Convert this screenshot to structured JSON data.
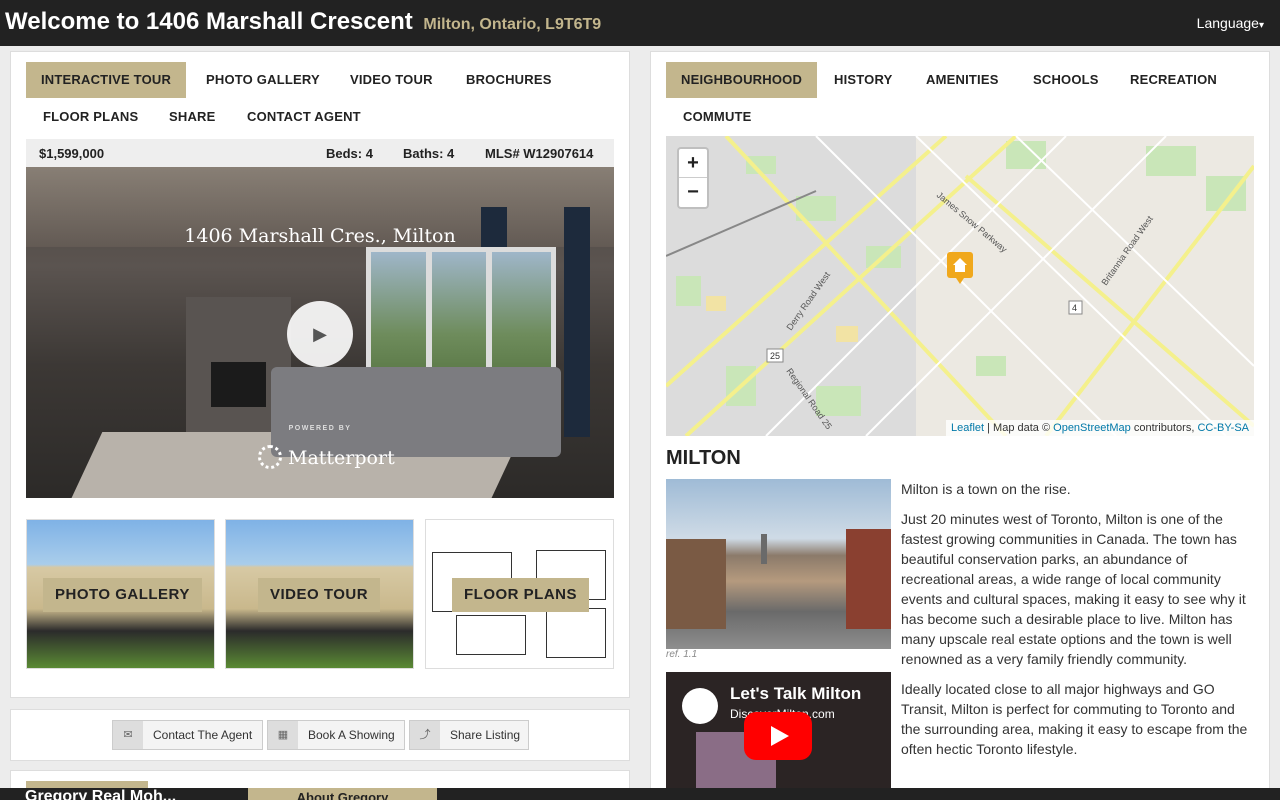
{
  "header": {
    "title": "Welcome to 1406 Marshall Crescent",
    "subtitle": "Milton, Ontario, L9T6T9",
    "language": "Language"
  },
  "left_tabs": [
    "INTERACTIVE TOUR",
    "PHOTO GALLERY",
    "VIDEO TOUR",
    "BROCHURES",
    "FLOOR PLANS",
    "SHARE",
    "CONTACT AGENT"
  ],
  "listing": {
    "price": "$1,599,000",
    "beds": "Beds: 4",
    "baths": "Baths: 4",
    "mls": "MLS# W12907614"
  },
  "tour": {
    "caption": "1406 Marshall Cres., Milton",
    "powered_by": "POWERED BY",
    "brand": "Matterport"
  },
  "thumbs": [
    "PHOTO GALLERY",
    "VIDEO TOUR",
    "FLOOR PLANS"
  ],
  "actions": {
    "contact": "Contact The Agent",
    "showing": "Book A Showing",
    "share": "Share Listing"
  },
  "footer": {
    "agent_name": "Gregory Real Moh...",
    "about_tab": "About Gregory"
  },
  "right_tabs": [
    "NEIGHBOURHOOD",
    "HISTORY",
    "AMENITIES",
    "SCHOOLS",
    "RECREATION",
    "COMMUTE"
  ],
  "map": {
    "zoom_in": "+",
    "zoom_out": "−",
    "attribution": {
      "leaflet": "Leaflet",
      "map_data": " | Map data © ",
      "osm": "OpenStreetMap",
      "contrib": " contributors, ",
      "license": "CC-BY-SA"
    },
    "road_labels": [
      "James Snow Parkway",
      "Britannia Road West",
      "Derry Road West",
      "Regional Road 25",
      "25",
      "4"
    ]
  },
  "neighbourhood": {
    "title": "MILTON",
    "photo_ref": "ref. 1.1",
    "paragraphs": [
      "Milton is a town on the rise.",
      "Just 20 minutes west of Toronto, Milton is one of the fastest growing communities in Canada. The town has beautiful conservation parks, an abundance of recreational areas, a wide range of local community events and cultural spaces, making it easy to see why it has become such a desirable place to live. Milton has many upscale real estate options and the town is well renowned as a very family friendly community.",
      "Ideally located close to all major highways and GO Transit, Milton is perfect for commuting to Toronto and the surrounding area, making it easy to escape from the often hectic Toronto lifestyle."
    ],
    "video": {
      "title": "Let's Talk Milton",
      "site": "DiscoverMilton.com"
    }
  },
  "colors": {
    "accent": "#c3b68d",
    "header_bg": "#222222",
    "link": "#0078a8"
  }
}
